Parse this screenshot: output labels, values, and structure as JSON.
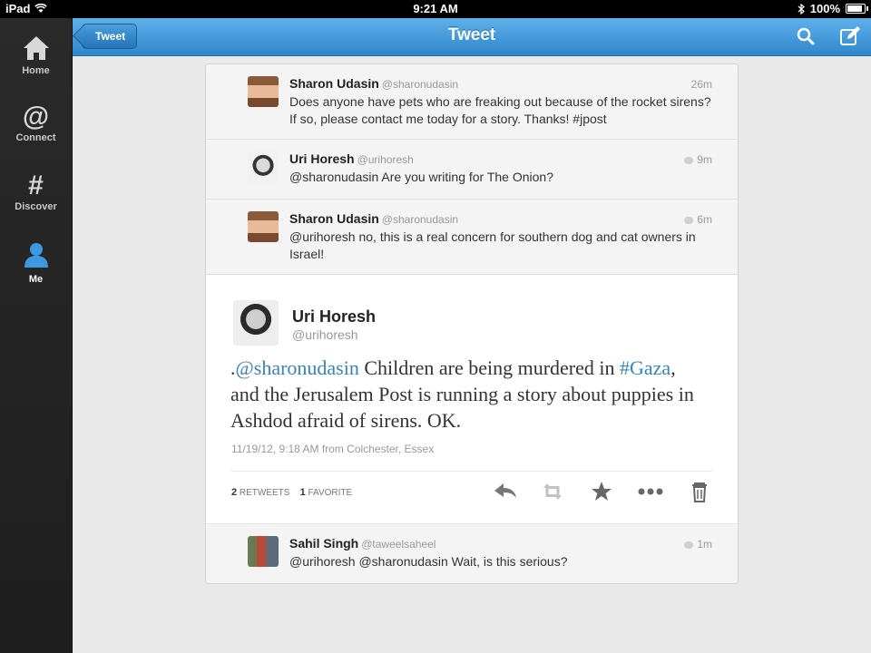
{
  "status_bar": {
    "device": "iPad",
    "time": "9:21 AM",
    "battery": "100%",
    "battery_level": 1.0
  },
  "sidebar": {
    "items": [
      {
        "label": "Home",
        "icon": "home-icon"
      },
      {
        "label": "Connect",
        "icon": "at-icon"
      },
      {
        "label": "Discover",
        "icon": "hash-icon"
      },
      {
        "label": "Me",
        "icon": "person-icon",
        "active": true
      }
    ]
  },
  "header": {
    "back_label": "Tweet",
    "title": "Tweet",
    "icons": [
      "search-icon",
      "compose-icon"
    ]
  },
  "replies_above": [
    {
      "name": "Sharon Udasin",
      "handle": "@sharonudasin",
      "time": "26m",
      "text": "Does anyone have pets who are freaking out because of the rocket sirens? If so, please contact me today for a story. Thanks! #jpost"
    },
    {
      "name": "Uri Horesh",
      "handle": "@urihoresh",
      "time": "9m",
      "text": "@sharonudasin Are you writing for The Onion?"
    },
    {
      "name": "Sharon Udasin",
      "handle": "@sharonudasin",
      "time": "6m",
      "text": "@urihoresh no, this is a real concern for southern dog and cat owners in Israel!"
    }
  ],
  "main_tweet": {
    "name": "Uri Horesh",
    "handle": "@urihoresh",
    "text_parts": [
      ".",
      "@sharonudasin",
      " Children are being murdered in ",
      "#Gaza",
      ", and the Jerusalem Post is running a story about puppies in Ashdod afraid of sirens. OK."
    ],
    "meta": "11/19/12, 9:18 AM from Colchester, Essex",
    "retweets_count": "2",
    "retweets_label": "RETWEETS",
    "favorites_count": "1",
    "favorites_label": "FAVORITE",
    "actions": [
      "reply-icon",
      "retweet-icon",
      "favorite-star-icon",
      "more-icon",
      "delete-icon"
    ]
  },
  "reply_below": {
    "name": "Sahil Singh",
    "handle": "@taweelsaheel",
    "time": "1m",
    "text": "@urihoresh @sharonudasin Wait, is this serious?"
  },
  "colors": {
    "header_blue": "#3d93d6",
    "link_blue": "#3b82b5",
    "sidebar_dark": "#222222",
    "active_blue": "#3d9ae0"
  }
}
